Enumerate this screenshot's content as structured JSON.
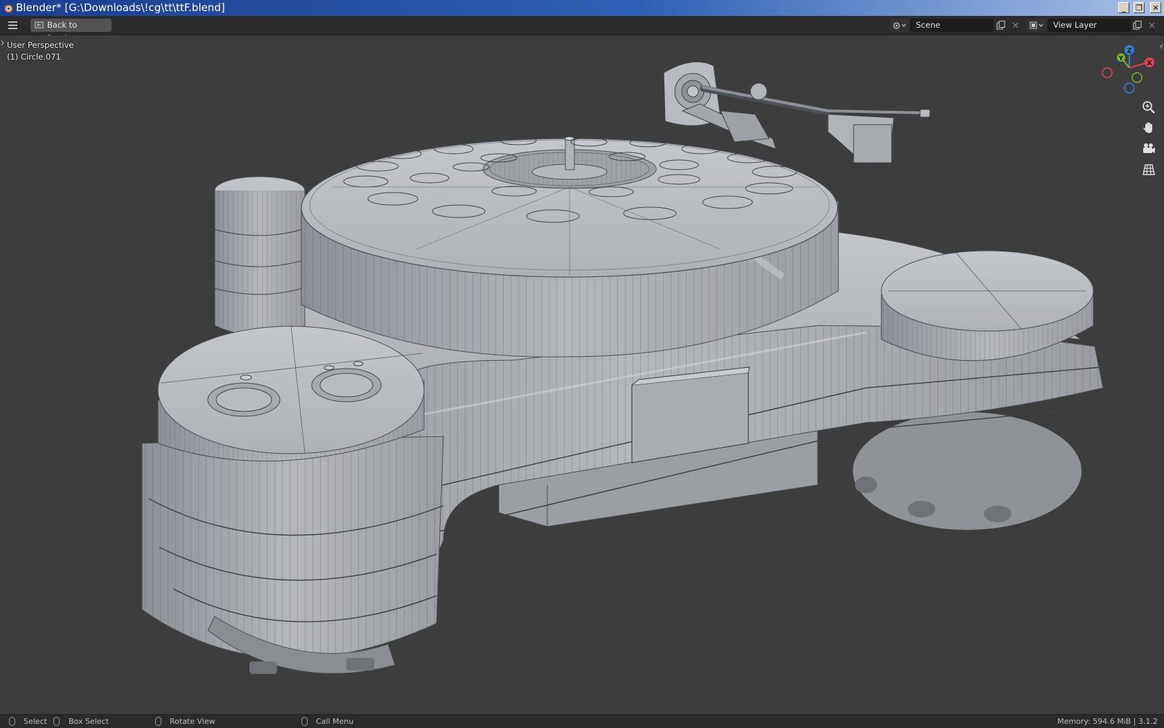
{
  "window": {
    "title": "Blender* [G:\\Downloads\\!cg\\tt\\ttF.blend]",
    "buttons": [
      "_",
      "❐",
      "✕"
    ]
  },
  "header": {
    "back_label": "Back to Previous",
    "scene": {
      "value": "Scene"
    },
    "view_layer": {
      "value": "View Layer"
    }
  },
  "viewport": {
    "perspective": "User Perspective",
    "object": "(1) Circle.071",
    "gizmo": {
      "x": "X",
      "y": "Y",
      "z": "Z"
    },
    "colors": {
      "x": "#e0434e",
      "y": "#75b62b",
      "z": "#2f83e3",
      "background": "#3d3d3d",
      "model": "#b7bac0"
    }
  },
  "statusbar": {
    "select": "Select",
    "box_select": "Box Select",
    "rotate_view": "Rotate View",
    "call_menu": "Call Menu",
    "info": "Memory: 594.6 MiB | 3.1.2"
  }
}
